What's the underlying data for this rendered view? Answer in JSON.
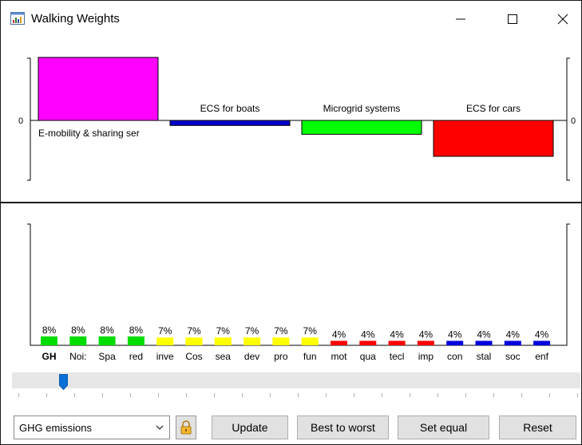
{
  "window": {
    "title": "Walking Weights",
    "controls": {
      "minimize": "—",
      "maximize": "☐",
      "close": "✕"
    }
  },
  "top_chart": {
    "axis_zero_left": "0",
    "axis_zero_right": "0",
    "alternatives": [
      {
        "label": "E-mobility & sharing ser",
        "value": 1.0,
        "color": "#ff00ff",
        "label_position": "below"
      },
      {
        "label": "ECS for boats",
        "value": -0.08,
        "color": "#0000cc",
        "label_position": "above"
      },
      {
        "label": "Microgrid systems",
        "value": -0.22,
        "color": "#00ff00",
        "label_position": "above"
      },
      {
        "label": "ECS for cars",
        "value": -0.57,
        "color": "#ff0000",
        "label_position": "above"
      }
    ]
  },
  "chart_data": {
    "type": "bar",
    "categories": [
      "GH",
      "Noi:",
      "Spa",
      "red",
      "inve",
      "Cos",
      "sea",
      "dev",
      "pro",
      "fun",
      "mot",
      "qua",
      "tecl",
      "imp",
      "con",
      "stal",
      "soc",
      "enf"
    ],
    "values": [
      8,
      8,
      8,
      8,
      7,
      7,
      7,
      7,
      7,
      7,
      4,
      4,
      4,
      4,
      4,
      4,
      4,
      4
    ],
    "value_labels": [
      "8%",
      "8%",
      "8%",
      "8%",
      "7%",
      "7%",
      "7%",
      "7%",
      "7%",
      "7%",
      "4%",
      "4%",
      "4%",
      "4%",
      "4%",
      "4%",
      "4%",
      "4%"
    ],
    "colors": [
      "#00dd00",
      "#00dd00",
      "#00dd00",
      "#00dd00",
      "#ffff00",
      "#ffff00",
      "#ffff00",
      "#ffff00",
      "#ffff00",
      "#ffff00",
      "#ff0000",
      "#ff0000",
      "#ff0000",
      "#ff0000",
      "#0000dd",
      "#0000dd",
      "#0000dd",
      "#0000dd"
    ],
    "selected_index": 0
  },
  "slider": {
    "position": 0.09
  },
  "controls": {
    "criterion_select": "GHG emissions",
    "lock_icon": "padlock-icon",
    "update_label": "Update",
    "best_to_worst_label": "Best to worst",
    "set_equal_label": "Set equal",
    "reset_label": "Reset"
  }
}
